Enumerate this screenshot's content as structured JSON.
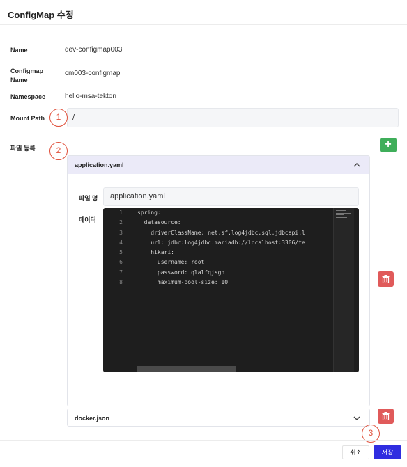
{
  "header": {
    "title": "ConfigMap 수정"
  },
  "fields": {
    "name_label": "Name",
    "name_value": "dev-configmap003",
    "configmap_name_label_line1": "Configmap",
    "configmap_name_label_line2": "Name",
    "configmap_name_value": "cm003-configmap",
    "namespace_label": "Namespace",
    "namespace_value": "hello-msa-tekton",
    "mount_path_label": "Mount Path",
    "mount_path_value": "/"
  },
  "files_section": {
    "label": "파일 등록",
    "add_button": "+",
    "files": [
      {
        "name": "application.yaml",
        "expanded": true
      },
      {
        "name": "docker.json",
        "expanded": false
      }
    ],
    "filename_label": "파일 명",
    "filename_value": "application.yaml",
    "data_label": "데이터"
  },
  "editor": {
    "lines": [
      {
        "num": "1",
        "text": "spring:"
      },
      {
        "num": "2",
        "text": "  datasource:"
      },
      {
        "num": "3",
        "text": "    driverClassName: net.sf.log4jdbc.sql.jdbcapi.l"
      },
      {
        "num": "4",
        "text": "    url: jdbc:log4jdbc:mariadb://localhost:3306/te"
      },
      {
        "num": "5",
        "text": "    hikari:"
      },
      {
        "num": "6",
        "text": "      username: root"
      },
      {
        "num": "7",
        "text": "      password: qlalfqjsgh"
      },
      {
        "num": "8",
        "text": "      maximum-pool-size: 10"
      }
    ]
  },
  "steps": [
    "1",
    "2",
    "3"
  ],
  "footer": {
    "cancel_label": "취소",
    "save_label": "저장"
  },
  "colors": {
    "accent": "#2f2de0",
    "add": "#3fae5a",
    "delete": "#e05a5a",
    "step": "#e0513c",
    "panel_header": "#ebeaf8"
  }
}
